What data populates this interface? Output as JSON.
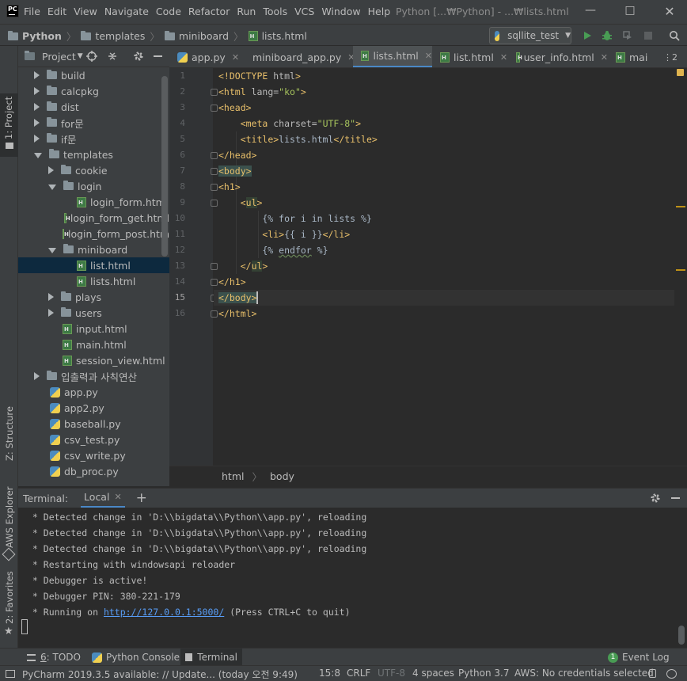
{
  "titlebar": {
    "logo": "PC",
    "menu": [
      "File",
      "Edit",
      "View",
      "Navigate",
      "Code",
      "Refactor",
      "Run",
      "Tools",
      "VCS",
      "Window",
      "Help"
    ],
    "title": "Python [...₩Python] - ...₩lists.html"
  },
  "navbar": {
    "crumbs": [
      "Python",
      "templates",
      "miniboard",
      "lists.html"
    ],
    "run_config": "sqllite_test"
  },
  "left_strip": {
    "project": "1: Project",
    "structure": "Z: Structure",
    "aws": "AWS Explorer",
    "favorites": "2: Favorites"
  },
  "project_panel": {
    "title": "Project",
    "tree": [
      {
        "label": "build",
        "type": "folder",
        "state": "collapsed",
        "depth": 0
      },
      {
        "label": "calcpkg",
        "type": "folder",
        "state": "collapsed",
        "depth": 0
      },
      {
        "label": "dist",
        "type": "folder",
        "state": "collapsed",
        "depth": 0
      },
      {
        "label": "for문",
        "type": "folder",
        "state": "collapsed",
        "depth": 0
      },
      {
        "label": "if문",
        "type": "folder",
        "state": "collapsed",
        "depth": 0
      },
      {
        "label": "templates",
        "type": "folder",
        "state": "expanded",
        "depth": 0
      },
      {
        "label": "cookie",
        "type": "folder",
        "state": "collapsed",
        "depth": 1
      },
      {
        "label": "login",
        "type": "folder",
        "state": "expanded",
        "depth": 1
      },
      {
        "label": "login_form.html",
        "type": "html",
        "depth": 2
      },
      {
        "label": "login_form_get.html",
        "type": "html",
        "depth": 2
      },
      {
        "label": "login_form_post.html",
        "type": "html",
        "depth": 2
      },
      {
        "label": "miniboard",
        "type": "folder",
        "state": "expanded",
        "depth": 1
      },
      {
        "label": "list.html",
        "type": "html",
        "depth": 2,
        "selected": true
      },
      {
        "label": "lists.html",
        "type": "html",
        "depth": 2
      },
      {
        "label": "plays",
        "type": "folder",
        "state": "collapsed",
        "depth": 1
      },
      {
        "label": "users",
        "type": "folder",
        "state": "collapsed",
        "depth": 1
      },
      {
        "label": "input.html",
        "type": "html",
        "depth": 1
      },
      {
        "label": "main.html",
        "type": "html",
        "depth": 1
      },
      {
        "label": "session_view.html",
        "type": "html",
        "depth": 1
      },
      {
        "label": "입출력과 사칙연산",
        "type": "folder",
        "state": "collapsed",
        "depth": 0
      },
      {
        "label": "app.py",
        "type": "py",
        "depth": 0
      },
      {
        "label": "app2.py",
        "type": "py",
        "depth": 0
      },
      {
        "label": "baseball.py",
        "type": "py",
        "depth": 0
      },
      {
        "label": "csv_test.py",
        "type": "py",
        "depth": 0
      },
      {
        "label": "csv_write.py",
        "type": "py",
        "depth": 0
      },
      {
        "label": "db_proc.py",
        "type": "py",
        "depth": 0
      }
    ]
  },
  "editor_tabs": [
    {
      "label": "app.py",
      "type": "py"
    },
    {
      "label": "miniboard_app.py",
      "type": "py"
    },
    {
      "label": "lists.html",
      "type": "html",
      "active": true
    },
    {
      "label": "list.html",
      "type": "html"
    },
    {
      "label": "user_info.html",
      "type": "html"
    },
    {
      "label": "mai",
      "type": "html"
    }
  ],
  "editor_tabs_overflow": "⋮2",
  "editor": {
    "line_numbers": [
      "1",
      "2",
      "3",
      "4",
      "5",
      "6",
      "7",
      "8",
      "9",
      "10",
      "11",
      "12",
      "13",
      "14",
      "15",
      "16"
    ],
    "current_line": "15"
  },
  "editor_breadcrumb": [
    "html",
    "body"
  ],
  "terminal": {
    "label": "Terminal:",
    "tab": "Local",
    "lines": [
      " * Detected change in 'D:\\\\bigdata\\\\Python\\\\app.py', reloading",
      " * Detected change in 'D:\\\\bigdata\\\\Python\\\\app.py', reloading",
      " * Detected change in 'D:\\\\bigdata\\\\Python\\\\app.py', reloading",
      " * Restarting with windowsapi reloader",
      " * Debugger is active!",
      " * Debugger PIN: 380-221-179"
    ],
    "running_prefix": " * Running on ",
    "running_url": "http://127.0.0.1:5000/",
    "running_suffix": " (Press CTRL+C to quit)"
  },
  "toolwindows": {
    "todo_num": "6",
    "todo": ": TODO",
    "console": "Python Console",
    "terminal": "Terminal",
    "event_count": "1",
    "event_log": "Event Log"
  },
  "statusbar": {
    "message": "PyCharm 2019.3.5 available: // Update... (today 오전 9:49)",
    "position": "15:8",
    "line_sep": "CRLF",
    "encoding": "UTF-8",
    "indent": "4 spaces",
    "interpreter": "Python 3.7",
    "aws": "AWS: No credentials selected"
  },
  "colors": {
    "accent": "#4a88c7",
    "tag": "#e8bf6a",
    "string": "#a5c25c",
    "link": "#589df6"
  }
}
